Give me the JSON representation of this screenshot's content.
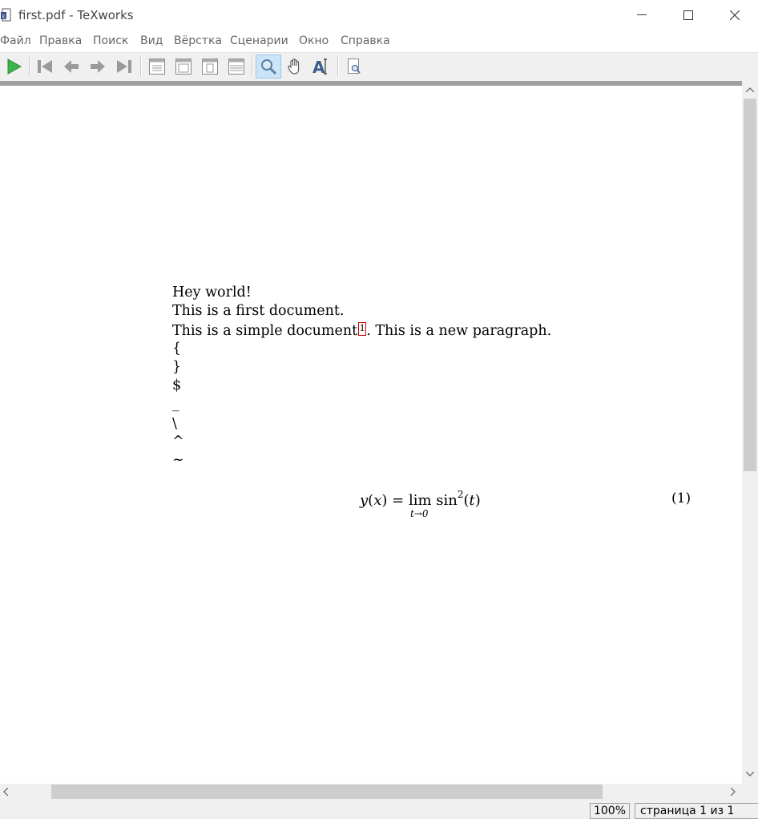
{
  "window": {
    "title": "first.pdf - TeXworks"
  },
  "menu": [
    "Файл",
    "Правка",
    "Поиск",
    "Вид",
    "Вёрстка",
    "Сценарии",
    "Окно",
    "Справка"
  ],
  "toolbar": {
    "icons": [
      "play-icon",
      "first-page-icon",
      "previous-page-icon",
      "next-page-icon",
      "last-page-icon",
      "single-page-icon",
      "continuous-icon",
      "two-pages-icon",
      "fit-width-icon",
      "magnifier-icon",
      "hand-icon",
      "select-text-icon",
      "find-in-pdf-icon"
    ],
    "active_tool": "magnifier-icon",
    "run_color": "#3cb44b"
  },
  "document": {
    "lines": [
      "Hey world!",
      "This is a first document.",
      "This is a simple document",
      ". This is a new paragraph.",
      "{",
      "}",
      "$",
      "_",
      "\\",
      "^",
      "~"
    ],
    "footnote_mark": "1",
    "equation": {
      "lhs_func": "y",
      "lhs_var": "x",
      "eq": "=",
      "lim": "lim",
      "lim_sub": "t→0",
      "func": "sin",
      "power": "2",
      "arg": "t",
      "number": "(1)"
    }
  },
  "status": {
    "zoom": "100%",
    "page": "страница 1 из 1"
  }
}
